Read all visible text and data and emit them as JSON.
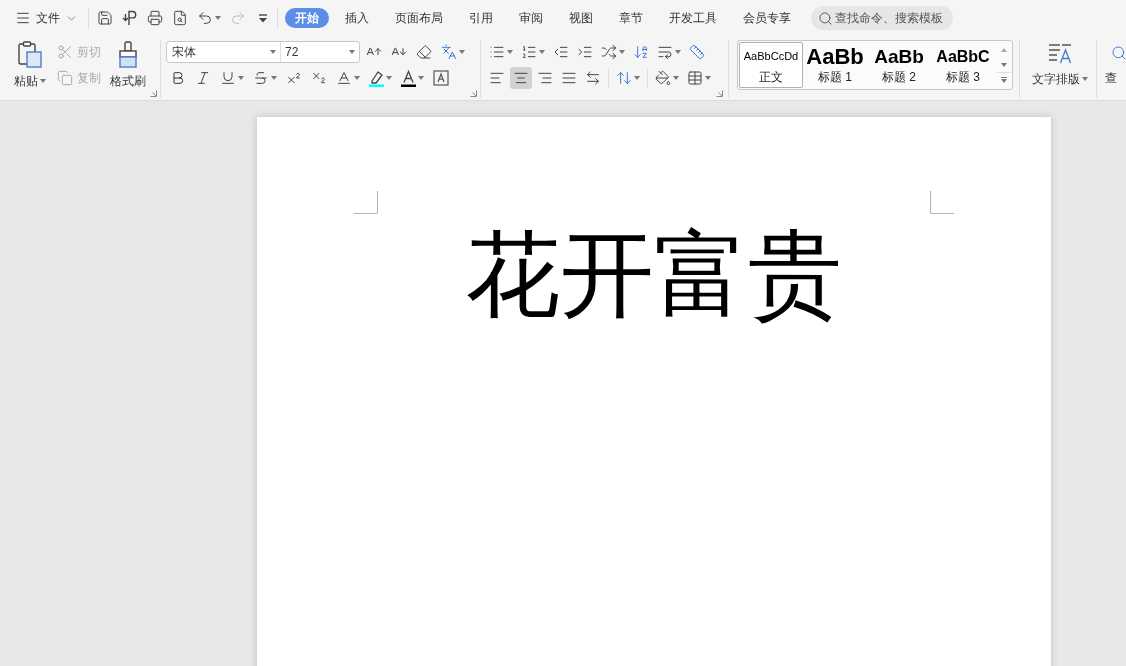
{
  "menu": {
    "label": "文件"
  },
  "quick_access": [
    {
      "kind": "save",
      "disabled": false
    },
    {
      "kind": "export",
      "disabled": false
    },
    {
      "kind": "print",
      "disabled": false
    },
    {
      "kind": "preview",
      "disabled": false
    },
    {
      "kind": "undo",
      "disabled": false
    },
    {
      "kind": "redo",
      "disabled": true
    },
    {
      "kind": "customize",
      "disabled": false
    }
  ],
  "tabs": [
    {
      "label": "开始",
      "selected": true
    },
    {
      "label": "插入",
      "selected": false
    },
    {
      "label": "页面布局",
      "selected": false
    },
    {
      "label": "引用",
      "selected": false
    },
    {
      "label": "审阅",
      "selected": false
    },
    {
      "label": "视图",
      "selected": false
    },
    {
      "label": "章节",
      "selected": false
    },
    {
      "label": "开发工具",
      "selected": false
    },
    {
      "label": "会员专享",
      "selected": false
    }
  ],
  "search": {
    "placeholder": "查找命令、搜索模板"
  },
  "clipboard": {
    "paste": "粘贴",
    "cut": {
      "label": "剪切",
      "disabled": true
    },
    "copy": {
      "label": "复制",
      "disabled": true
    },
    "format_painter": "格式刷"
  },
  "font": {
    "name": "宋体",
    "size": "72"
  },
  "paragraph": {
    "alignment": [
      {
        "kind": "left",
        "selected": false
      },
      {
        "kind": "center",
        "selected": true
      },
      {
        "kind": "right",
        "selected": false
      },
      {
        "kind": "justify",
        "selected": false
      },
      {
        "kind": "distributed",
        "selected": false
      }
    ]
  },
  "styles": [
    {
      "kind": "body",
      "preview": "AaBbCcDd",
      "label": "正文",
      "selected": true
    },
    {
      "kind": "h1",
      "preview": "AaBb",
      "label": "标题 1",
      "selected": false
    },
    {
      "kind": "h2",
      "preview": "AaBb",
      "label": "标题 2",
      "selected": false
    },
    {
      "kind": "h3",
      "preview": "AaBbC",
      "label": "标题 3",
      "selected": false
    }
  ],
  "text_layout": {
    "label": "文字排版"
  },
  "find": {
    "label": "查"
  },
  "document": {
    "heading": "花开富贵"
  }
}
